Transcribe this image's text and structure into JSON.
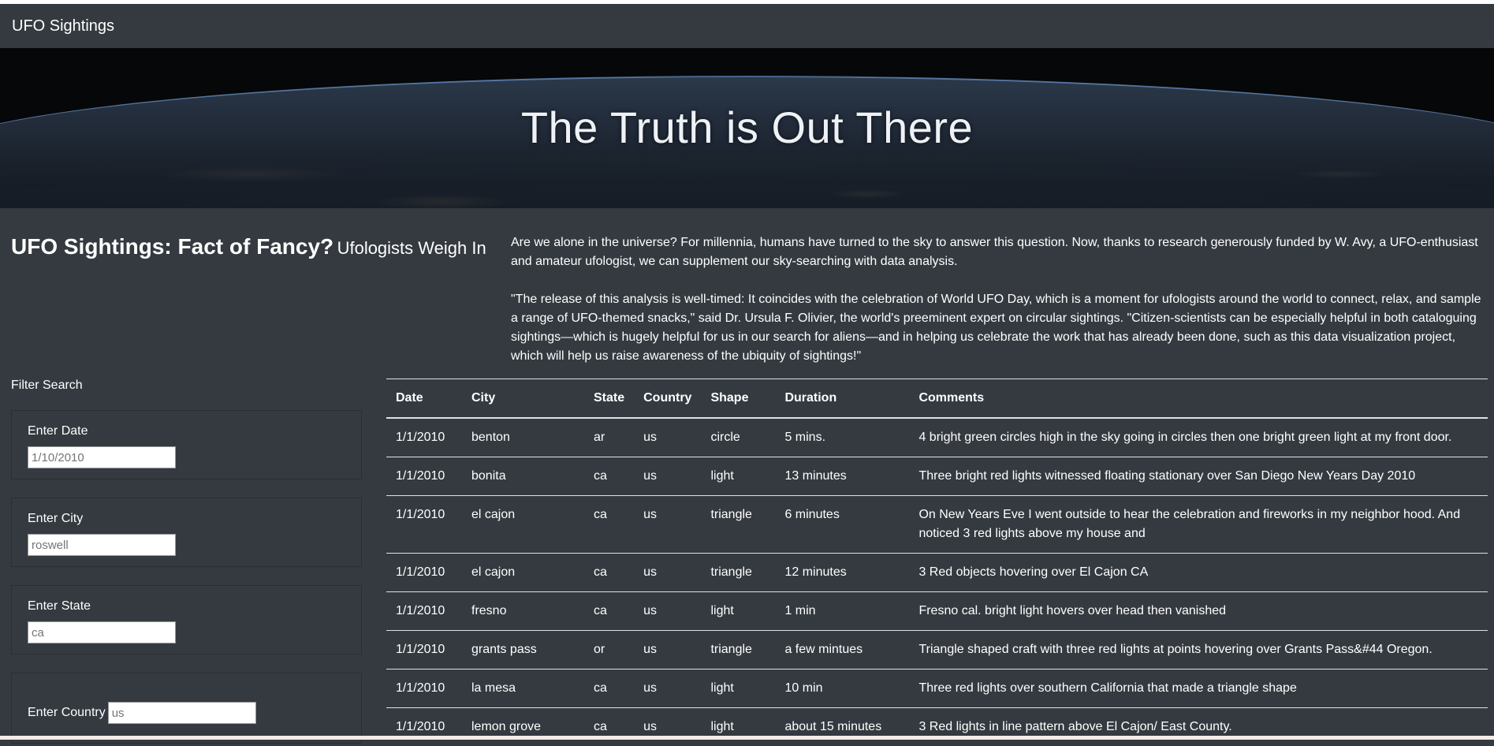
{
  "navbar": {
    "brand": "UFO Sightings"
  },
  "hero": {
    "title": "The Truth is Out There"
  },
  "article": {
    "title": "UFO Sightings: Fact of Fancy?",
    "subtitle": "Ufologists Weigh In",
    "paragraphs": [
      "Are we alone in the universe? For millennia, humans have turned to the sky to answer this question. Now, thanks to research generously funded by W. Avy, a UFO-enthusiast and amateur ufologist, we can supplement our sky-searching with data analysis.",
      "\"The release of this analysis is well-timed: It coincides with the celebration of World UFO Day, which is a moment for ufologists around the world to connect, relax, and sample a range of UFO-themed snacks,\" said Dr. Ursula F. Olivier, the world's preeminent expert on circular sightings. \"Citizen-scientists can be especially helpful in both cataloguing sightings—which is hugely helpful for us in our search for aliens—and in helping us celebrate the work that has already been done, such as this data visualization project, which will help us raise awareness of the ubiquity of sightings!\""
    ]
  },
  "filters": {
    "title": "Filter Search",
    "date": {
      "label": "Enter Date",
      "placeholder": "1/10/2010"
    },
    "city": {
      "label": "Enter City",
      "placeholder": "roswell"
    },
    "state": {
      "label": "Enter State",
      "placeholder": "ca"
    },
    "country": {
      "label": "Enter Country",
      "placeholder": "us"
    }
  },
  "table": {
    "headers": [
      "Date",
      "City",
      "State",
      "Country",
      "Shape",
      "Duration",
      "Comments"
    ],
    "rows": [
      [
        "1/1/2010",
        "benton",
        "ar",
        "us",
        "circle",
        "5 mins.",
        "4 bright green circles high in the sky going in circles then one bright green light at my front door."
      ],
      [
        "1/1/2010",
        "bonita",
        "ca",
        "us",
        "light",
        "13 minutes",
        "Three bright red lights witnessed floating stationary over San Diego New Years Day 2010"
      ],
      [
        "1/1/2010",
        "el cajon",
        "ca",
        "us",
        "triangle",
        "6 minutes",
        "On New Years Eve I went outside to hear the celebration and fireworks in my neighbor hood. And noticed 3 red lights above my house and"
      ],
      [
        "1/1/2010",
        "el cajon",
        "ca",
        "us",
        "triangle",
        "12 minutes",
        "3 Red objects hovering over El Cajon CA"
      ],
      [
        "1/1/2010",
        "fresno",
        "ca",
        "us",
        "light",
        "1 min",
        "Fresno cal. bright light hovers over head then vanished"
      ],
      [
        "1/1/2010",
        "grants pass",
        "or",
        "us",
        "triangle",
        "a few mintues",
        "Triangle shaped craft with three red lights at points hovering over Grants Pass&#44 Oregon."
      ],
      [
        "1/1/2010",
        "la mesa",
        "ca",
        "us",
        "light",
        "10 min",
        "Three red lights over southern California that made a triangle shape"
      ],
      [
        "1/1/2010",
        "lemon grove",
        "ca",
        "us",
        "light",
        "about 15 minutes",
        "3 Red lights in line pattern above El Cajon/ East County."
      ]
    ]
  }
}
